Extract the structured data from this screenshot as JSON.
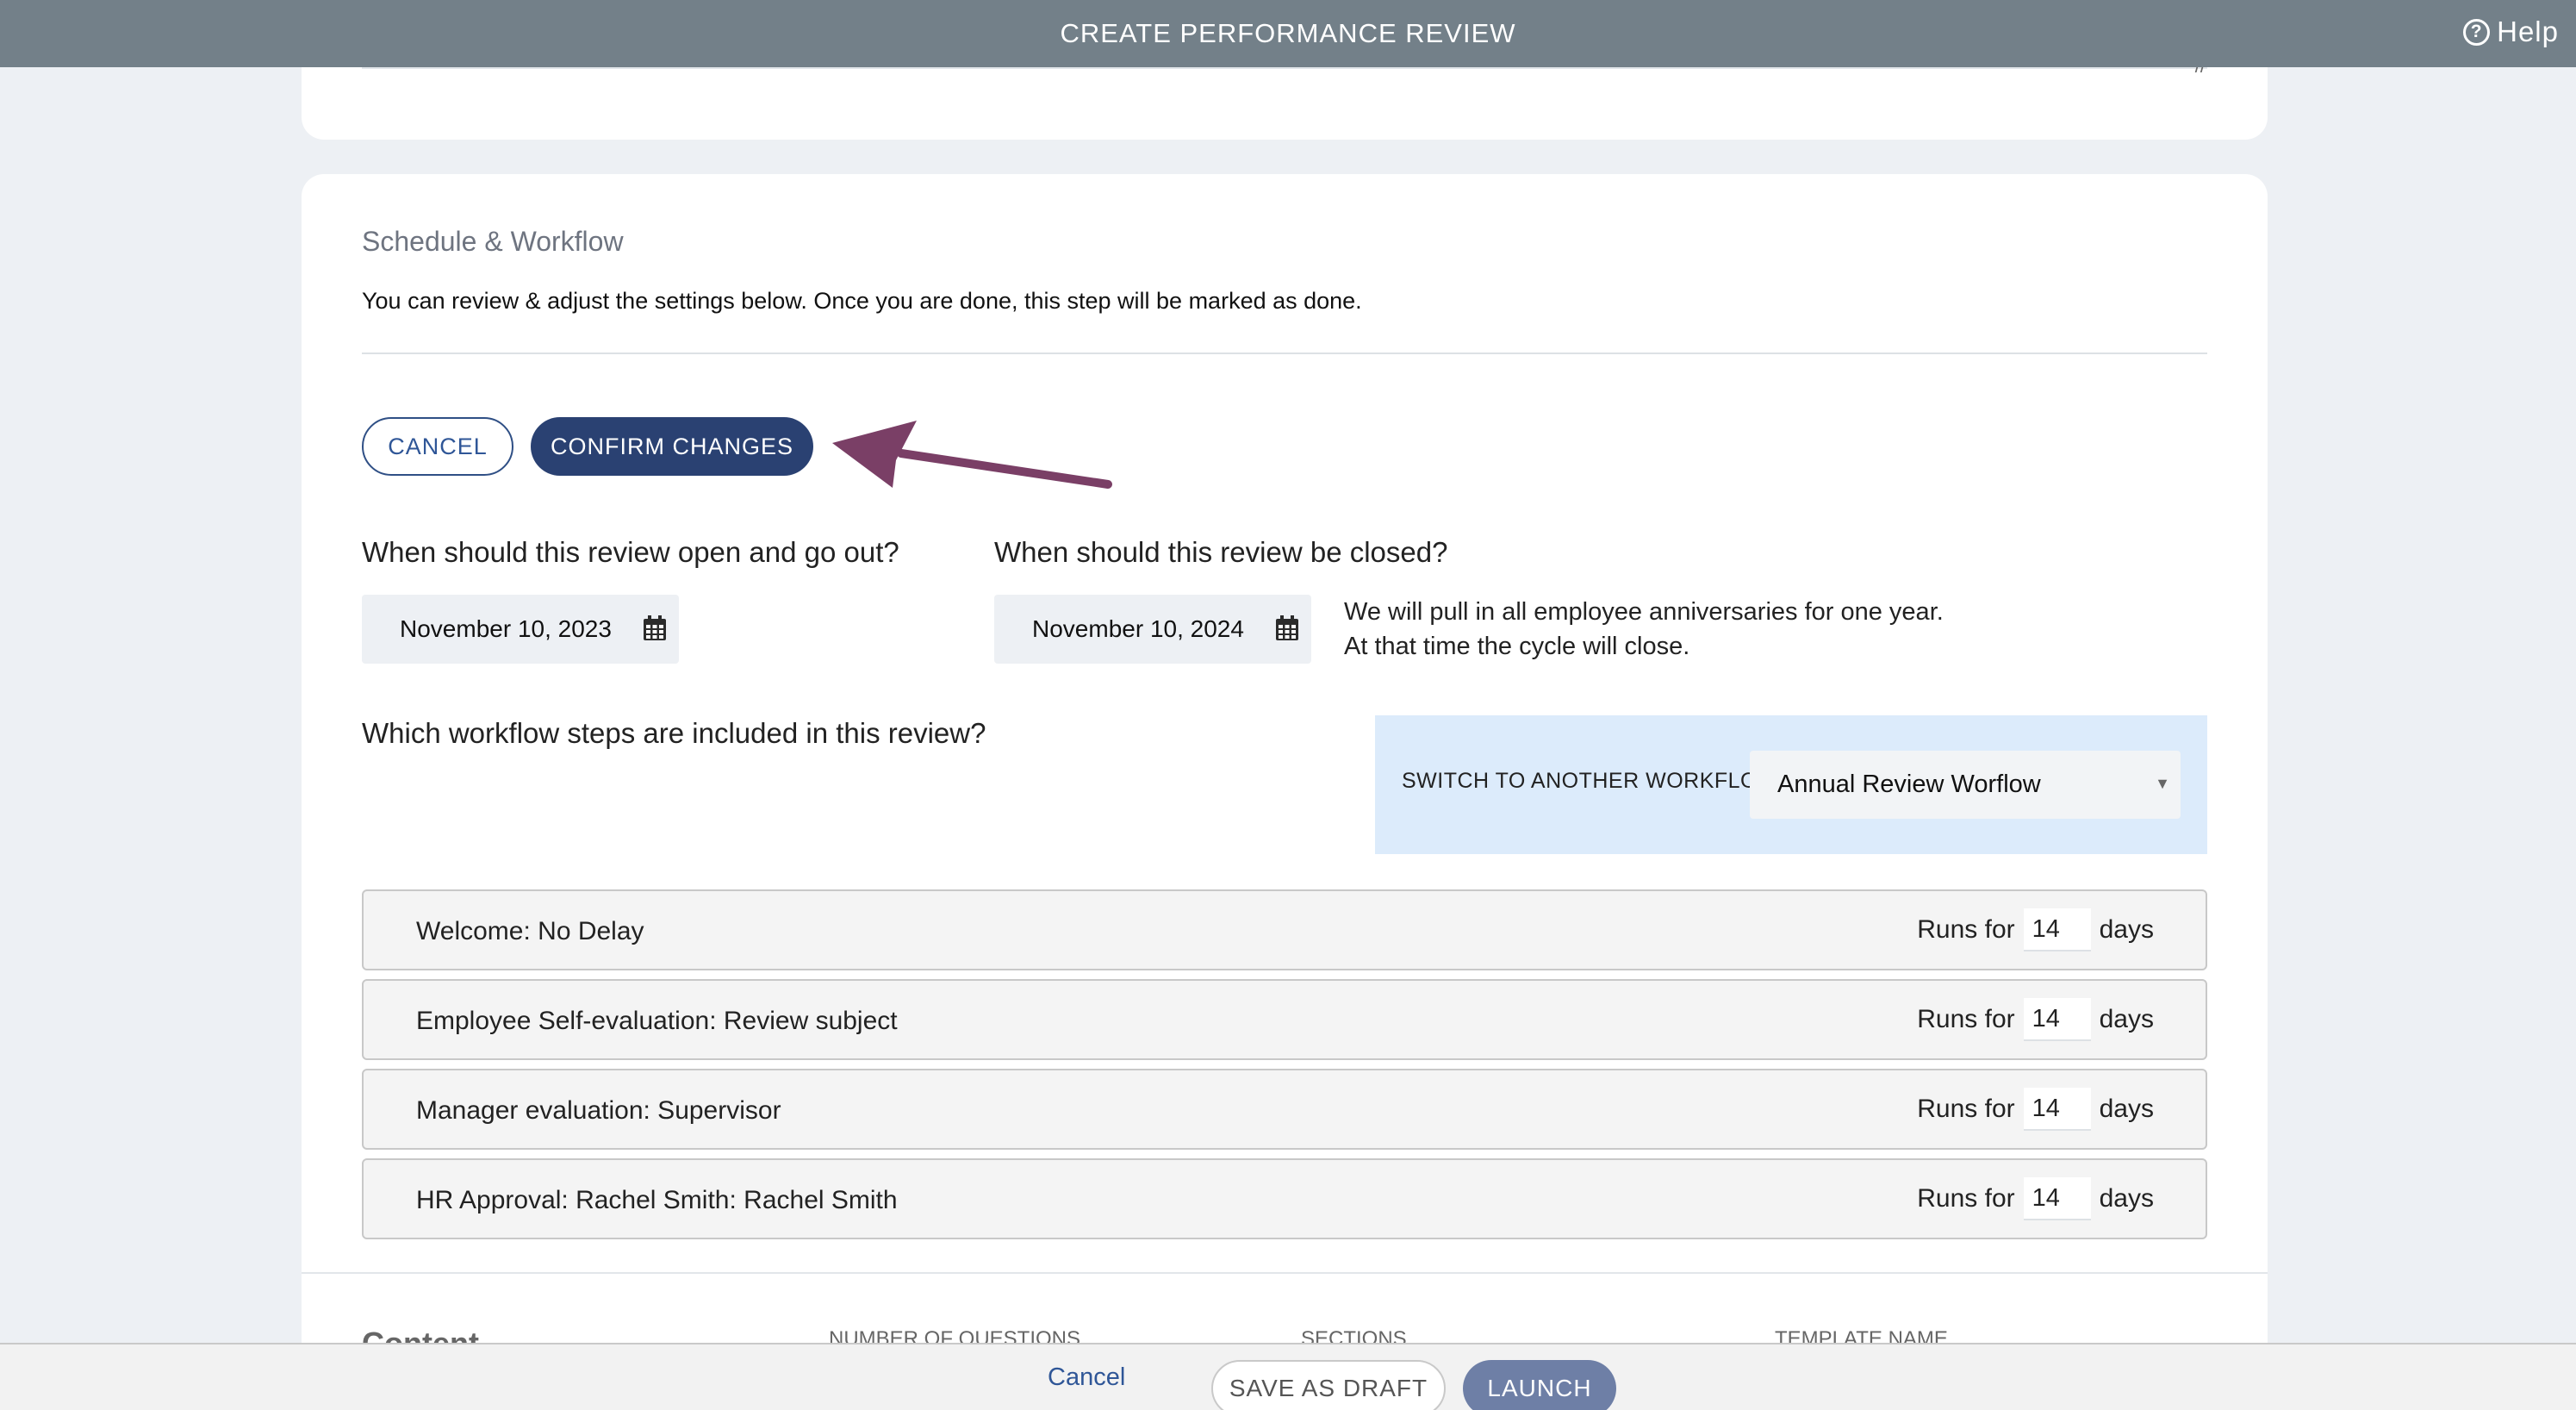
{
  "header": {
    "title": "CREATE PERFORMANCE REVIEW",
    "help_label": "Help"
  },
  "section": {
    "title": "Schedule & Workflow",
    "description": "You can review & adjust the settings below. Once you are done, this step will be marked as done."
  },
  "actions": {
    "cancel_label": "CANCEL",
    "confirm_label": "CONFIRM CHANGES"
  },
  "schedule": {
    "open_question": "When should this review open and go out?",
    "open_date": "November 10, 2023",
    "close_question": "When should this review be closed?",
    "close_date": "November 10, 2024",
    "note_line1": "We will pull in all employee anniversaries for one year.",
    "note_line2": "At that time the cycle will close."
  },
  "workflow": {
    "question": "Which workflow steps are included in this review?",
    "switch_label": "SWITCH TO ANOTHER WORKFLOW",
    "selected": "Annual Review Worflow",
    "steps": [
      {
        "name": "Welcome: No Delay",
        "runs_label": "Runs for",
        "days": "14",
        "days_label": "days"
      },
      {
        "name": "Employee Self-evaluation: Review subject",
        "runs_label": "Runs for",
        "days": "14",
        "days_label": "days"
      },
      {
        "name": "Manager evaluation: Supervisor",
        "runs_label": "Runs for",
        "days": "14",
        "days_label": "days"
      },
      {
        "name": "HR Approval: Rachel Smith: Rachel Smith",
        "runs_label": "Runs for",
        "days": "14",
        "days_label": "days"
      }
    ]
  },
  "content": {
    "title": "Content",
    "col_questions": "NUMBER OF QUESTIONS",
    "col_sections": "SECTIONS",
    "col_template": "TEMPLATE NAME"
  },
  "footer": {
    "cancel_label": "Cancel",
    "draft_label": "SAVE AS DRAFT",
    "launch_label": "LAUNCH"
  },
  "colors": {
    "header_bg": "#738089",
    "primary": "#2a4172",
    "annotation_arrow": "#7a3f66",
    "workflow_bg": "#dcebfb"
  },
  "icons": {
    "help": "question-circle-icon",
    "calendar": "calendar-icon",
    "dropdown": "caret-down-icon"
  }
}
